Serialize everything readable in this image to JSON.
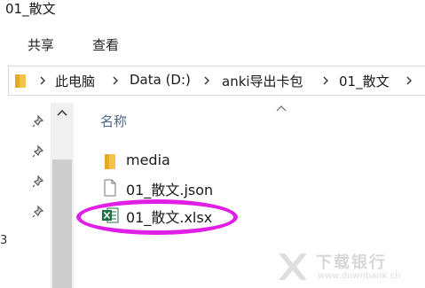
{
  "window": {
    "title": "01_散文"
  },
  "ribbon": {
    "tabs": [
      {
        "label": "共享"
      },
      {
        "label": "查看"
      }
    ]
  },
  "address_bar": {
    "crumbs": [
      {
        "label": "此电脑"
      },
      {
        "label": "Data (D:)"
      },
      {
        "label": "anki导出卡包"
      },
      {
        "label": "01_散文"
      }
    ]
  },
  "file_list": {
    "column_header": "名称",
    "items": [
      {
        "name": "media",
        "type": "folder",
        "icon": "folder-icon"
      },
      {
        "name": "01_散文.json",
        "type": "file",
        "icon": "document-icon"
      },
      {
        "name": "01_散文.xlsx",
        "type": "excel",
        "icon": "excel-icon",
        "highlighted": true
      }
    ]
  },
  "left_pane": {
    "edge_text": "3"
  },
  "watermark": {
    "text": "下载银行",
    "url": "www.downbank.cn"
  },
  "colors": {
    "highlight": "#e11ee6",
    "folder": "#f4c44a",
    "excel": "#1e7145"
  }
}
